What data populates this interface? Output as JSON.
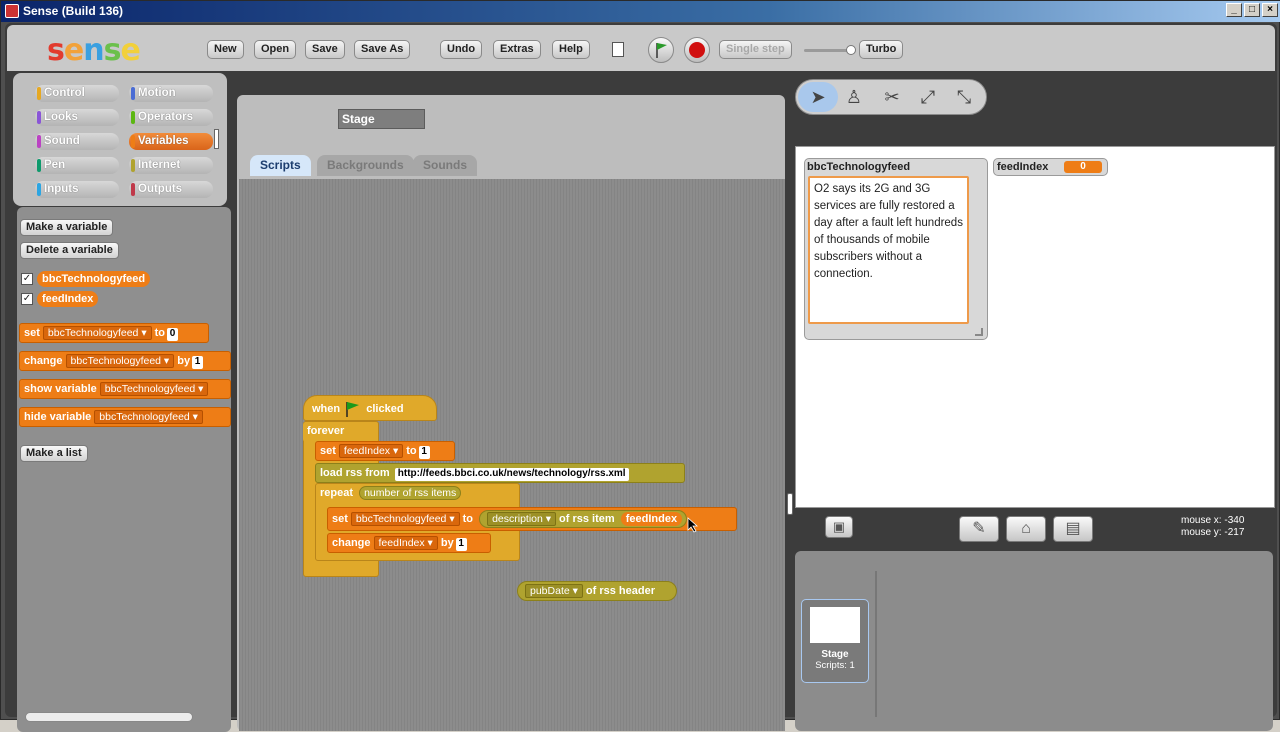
{
  "window": {
    "title": "Sense (Build 136)",
    "minimize": "_",
    "maximize": "□",
    "close": "×"
  },
  "logo": {
    "letters": [
      "s",
      "e",
      "n",
      "s",
      "e"
    ],
    "colors": [
      "#e23b2e",
      "#f2a23a",
      "#3aa0e0",
      "#6bc04b",
      "#f2d03a"
    ]
  },
  "toolbar": {
    "new": "New",
    "open": "Open",
    "save": "Save",
    "save_as": "Save As",
    "undo": "Undo",
    "extras": "Extras",
    "help": "Help",
    "single_step": "Single step",
    "turbo": "Turbo"
  },
  "categories": [
    {
      "label": "Control",
      "color": "#e6a822"
    },
    {
      "label": "Motion",
      "color": "#4a6cd4"
    },
    {
      "label": "Looks",
      "color": "#8a55d7"
    },
    {
      "label": "Operators",
      "color": "#5cb712"
    },
    {
      "label": "Sound",
      "color": "#bb42c3"
    },
    {
      "label": "Variables",
      "color": "#ee7d16"
    },
    {
      "label": "Pen",
      "color": "#0e9a6c"
    },
    {
      "label": "Internet",
      "color": "#b0a32f"
    },
    {
      "label": "Inputs",
      "color": "#2ca5e2"
    },
    {
      "label": "Outputs",
      "color": "#c0394a"
    }
  ],
  "palette": {
    "make_variable": "Make a variable",
    "delete_variable": "Delete a variable",
    "variables": [
      "bbcTechnologyfeed",
      "feedIndex"
    ],
    "check": "✓",
    "set_block": {
      "set": "set",
      "var": "bbcTechnologyfeed",
      "to": "to",
      "value": "0"
    },
    "change_block": {
      "change": "change",
      "var": "bbcTechnologyfeed",
      "by": "by",
      "value": "1"
    },
    "show_block": {
      "label": "show variable",
      "var": "bbcTechnologyfeed"
    },
    "hide_block": {
      "label": "hide variable",
      "var": "bbcTechnologyfeed"
    },
    "make_list": "Make a list"
  },
  "sprite_name": "Stage",
  "tabs": [
    "Scripts",
    "Backgrounds",
    "Sounds"
  ],
  "script": {
    "hat": {
      "when": "when",
      "clicked": "clicked"
    },
    "forever": "forever",
    "set1": {
      "set": "set",
      "var": "feedIndex",
      "to": "to",
      "value": "1"
    },
    "load": {
      "label": "load rss from",
      "url": "http://feeds.bbci.co.uk/news/technology/rss.xml"
    },
    "repeat": {
      "label": "repeat",
      "arg": "number of rss items"
    },
    "set2": {
      "set": "set",
      "var": "bbcTechnologyfeed",
      "to": "to",
      "field": "description",
      "of": "of rss item",
      "index": "feedIndex"
    },
    "change": {
      "change": "change",
      "var": "feedIndex",
      "by": "by",
      "value": "1"
    },
    "loose": {
      "field": "pubDate",
      "label": "of rss header"
    }
  },
  "stage": {
    "list_watcher": {
      "title": "bbcTechnologyfeed",
      "content": "O2 says its 2G and 3G services are fully restored a day after a fault left hundreds of thousands of mobile subscribers without a connection."
    },
    "var_watcher": {
      "name": "feedIndex",
      "value": "0"
    }
  },
  "mouse": {
    "x_label": "mouse x:",
    "x": "-340",
    "y_label": "mouse y:",
    "y": "-217"
  },
  "sprite_list": {
    "name": "Stage",
    "scripts": "Scripts: 1"
  }
}
